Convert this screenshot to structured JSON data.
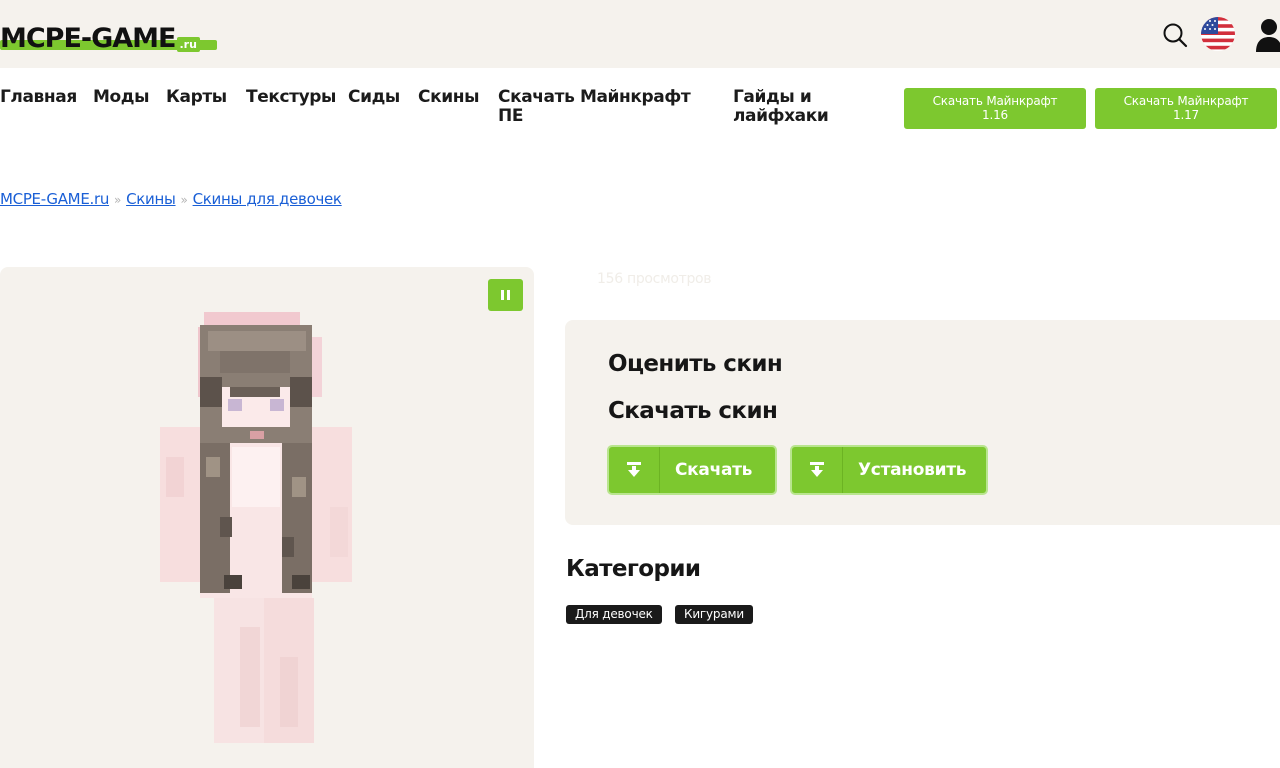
{
  "header": {
    "logo_text": "MCPE-GAME",
    "logo_suffix": ".ru",
    "icons": [
      "search-icon",
      "us-flag-icon",
      "user-icon"
    ]
  },
  "nav": {
    "items": [
      {
        "label": "Главная"
      },
      {
        "label": "Моды"
      },
      {
        "label": "Карты"
      },
      {
        "label": "Текстуры"
      },
      {
        "label": "Сиды"
      },
      {
        "label": "Скины"
      },
      {
        "label_line1": "Скачать Майнкрафт",
        "label_line2": "ПЕ"
      },
      {
        "label_line1": "Гайды и",
        "label_line2": "лайфхаки"
      }
    ],
    "download_buttons": [
      {
        "line1": "Скачать Майнкрафт",
        "line2": "1.16"
      },
      {
        "line1": "Скачать Майнкрафт",
        "line2": "1.17"
      }
    ]
  },
  "breadcrumb": {
    "items": [
      "MCPE-GAME.ru",
      "Скины",
      "Скины для девочек"
    ],
    "separator": "»"
  },
  "skin_viewer": {
    "pause_icon": "pause-icon"
  },
  "info": {
    "views": "156 просмотров",
    "rate_title": "Оценить скин",
    "download_title": "Скачать скин",
    "download_label": "Скачать",
    "install_label": "Установить"
  },
  "categories": {
    "title": "Категории",
    "tags": [
      "Для девочек",
      "Кигурами"
    ]
  },
  "colors": {
    "accent": "#7dc82f",
    "panel": "#f5f2ed",
    "link": "#1a5fd6",
    "tag_bg": "#1a1a1a"
  }
}
